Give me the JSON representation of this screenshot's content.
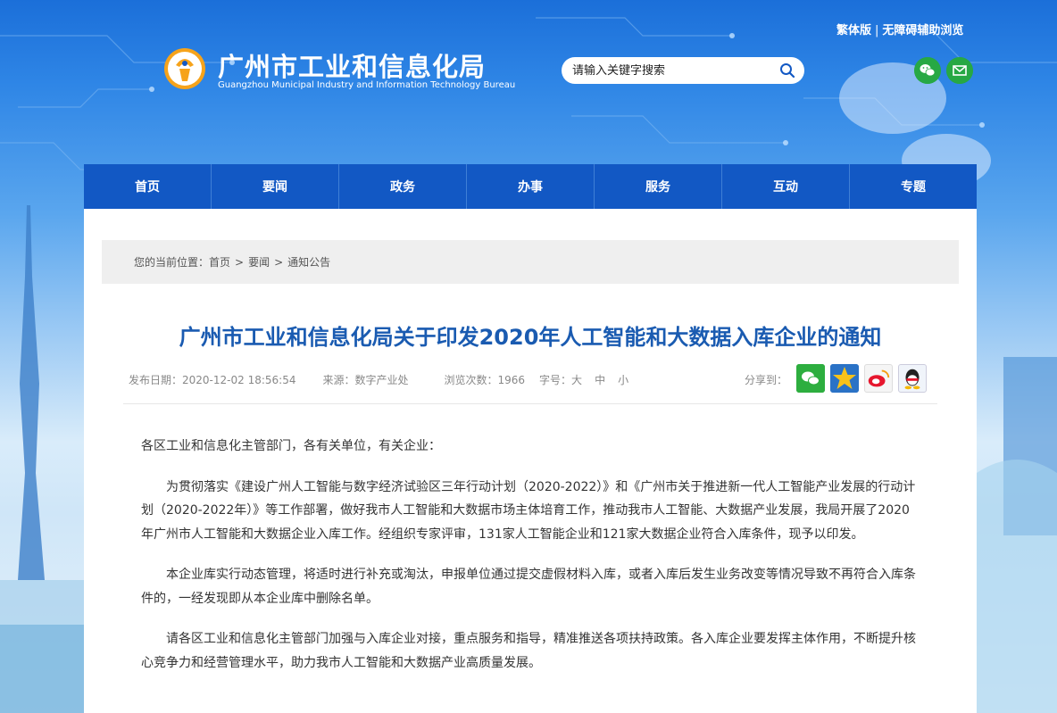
{
  "header": {
    "top_links": {
      "traditional": "繁体版",
      "separator": "|",
      "accessibility": "无障碍辅助浏览"
    },
    "site_title": "广州市工业和信息化局",
    "site_subtitle": "Guangzhou Municipal Industry and Information Technology Bureau",
    "search_placeholder": "请输入关键字搜索"
  },
  "nav": {
    "items": [
      "首页",
      "要闻",
      "政务",
      "办事",
      "服务",
      "互动",
      "专题"
    ]
  },
  "breadcrumb": {
    "prefix": "您的当前位置：",
    "items": [
      "首页",
      "要闻",
      "通知公告"
    ],
    "separator": ">"
  },
  "article": {
    "title": "广州市工业和信息化局关于印发2020年人工智能和大数据入库企业的通知",
    "meta": {
      "publish_label": "发布日期：",
      "publish_date": "2020-12-02 18:56:54",
      "source": "来源：数字产业处",
      "views": "浏览次数：1966",
      "font_size_label": "字号：",
      "sizes": [
        "大",
        "中",
        "小"
      ],
      "share_label": "分享到："
    },
    "salutation": "各区工业和信息化主管部门，各有关单位，有关企业：",
    "paragraphs": [
      "为贯彻落实《建设广州人工智能与数字经济试验区三年行动计划（2020-2022）》和《广州市关于推进新一代人工智能产业发展的行动计划（2020-2022年）》等工作部署，做好我市人工智能和大数据市场主体培育工作，推动我市人工智能、大数据产业发展，我局开展了2020年广州市人工智能和大数据企业入库工作。经组织专家评审，131家人工智能企业和121家大数据企业符合入库条件，现予以印发。",
      "本企业库实行动态管理，将适时进行补充或淘汰，申报单位通过提交虚假材料入库，或者入库后发生业务改变等情况导致不再符合入库条件的，一经发现即从本企业库中删除名单。",
      "请各区工业和信息化主管部门加强与入库企业对接，重点服务和指导，精准推送各项扶持政策。各入库企业要发挥主体作用，不断提升核心竞争力和经营管理水平，助力我市人工智能和大数据产业高质量发展。"
    ]
  },
  "colors": {
    "nav_bg": "#1258c4",
    "title": "#1a5bb1",
    "accent": "#28a745"
  }
}
